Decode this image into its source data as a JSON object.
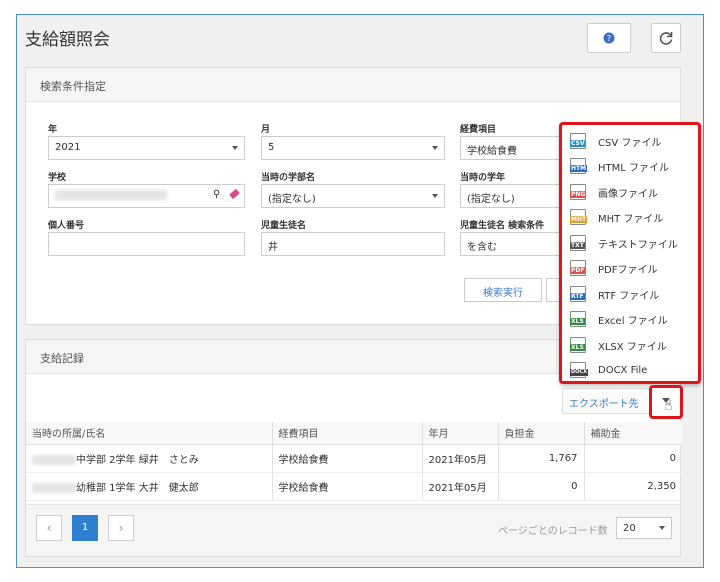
{
  "page": {
    "title": "支給額照会"
  },
  "search_panel": {
    "heading": "検索条件指定",
    "fields": [
      {
        "label": "年",
        "value": "2021"
      },
      {
        "label": "月",
        "value": "5"
      },
      {
        "label": "経費項目",
        "value": "学校給食費"
      },
      {
        "label": "学校",
        "value": ""
      },
      {
        "label": "当時の学部名",
        "value": "(指定なし)"
      },
      {
        "label": "当時の学年",
        "value": "(指定なし)"
      },
      {
        "label": "個人番号",
        "value": ""
      },
      {
        "label": "児童生徒名",
        "value": "井"
      },
      {
        "label": "児童生徒名 検索条件",
        "value": "を含む"
      }
    ],
    "search_button": "検索実行"
  },
  "records_panel": {
    "heading": "支給記録",
    "export_label": "エクスポート先",
    "columns": [
      "当時の所属/氏名",
      "経費項目",
      "年月",
      "負担金",
      "補助金"
    ],
    "rows": [
      {
        "name": "中学部 2学年 緑井　さとみ",
        "item": "学校給食費",
        "month": "2021年05月",
        "burden": "1,767",
        "subsidy": "0"
      },
      {
        "name": "幼稚部 1学年 大井　健太郎",
        "item": "学校給食費",
        "month": "2021年05月",
        "burden": "0",
        "subsidy": "2,350"
      }
    ],
    "current_page": "1",
    "per_page_label": "ページごとのレコード数",
    "per_page_value": "20"
  },
  "export_menu": {
    "items": [
      {
        "label": "CSV ファイル",
        "icon": "csv-icon",
        "tag": "CSV",
        "color": "#2a8fbd"
      },
      {
        "label": "HTML ファイル",
        "icon": "html-icon",
        "tag": "HTM",
        "color": "#2a6fbd"
      },
      {
        "label": "画像ファイル",
        "icon": "image-icon",
        "tag": "PNG",
        "color": "#d9534f"
      },
      {
        "label": "MHT ファイル",
        "icon": "mht-icon",
        "tag": "MHT",
        "color": "#e0a030"
      },
      {
        "label": "テキストファイル",
        "icon": "text-icon",
        "tag": "TXT",
        "color": "#555555"
      },
      {
        "label": "PDFファイル",
        "icon": "pdf-icon",
        "tag": "PDF",
        "color": "#d9534f"
      },
      {
        "label": "RTF ファイル",
        "icon": "rtf-icon",
        "tag": "RTF",
        "color": "#2a6fbd"
      },
      {
        "label": "Excel ファイル",
        "icon": "excel-icon",
        "tag": "XLS",
        "color": "#2e8b3e"
      },
      {
        "label": "XLSX ファイル",
        "icon": "xlsx-icon",
        "tag": "XLS",
        "color": "#2e8b3e"
      },
      {
        "label": "DOCX File",
        "icon": "docx-icon",
        "tag": "DOCX",
        "color": "#444444"
      }
    ]
  },
  "colors": {
    "accent": "#3a7bc8",
    "highlight": "#e0141c",
    "page_button": "#2f80d1"
  }
}
